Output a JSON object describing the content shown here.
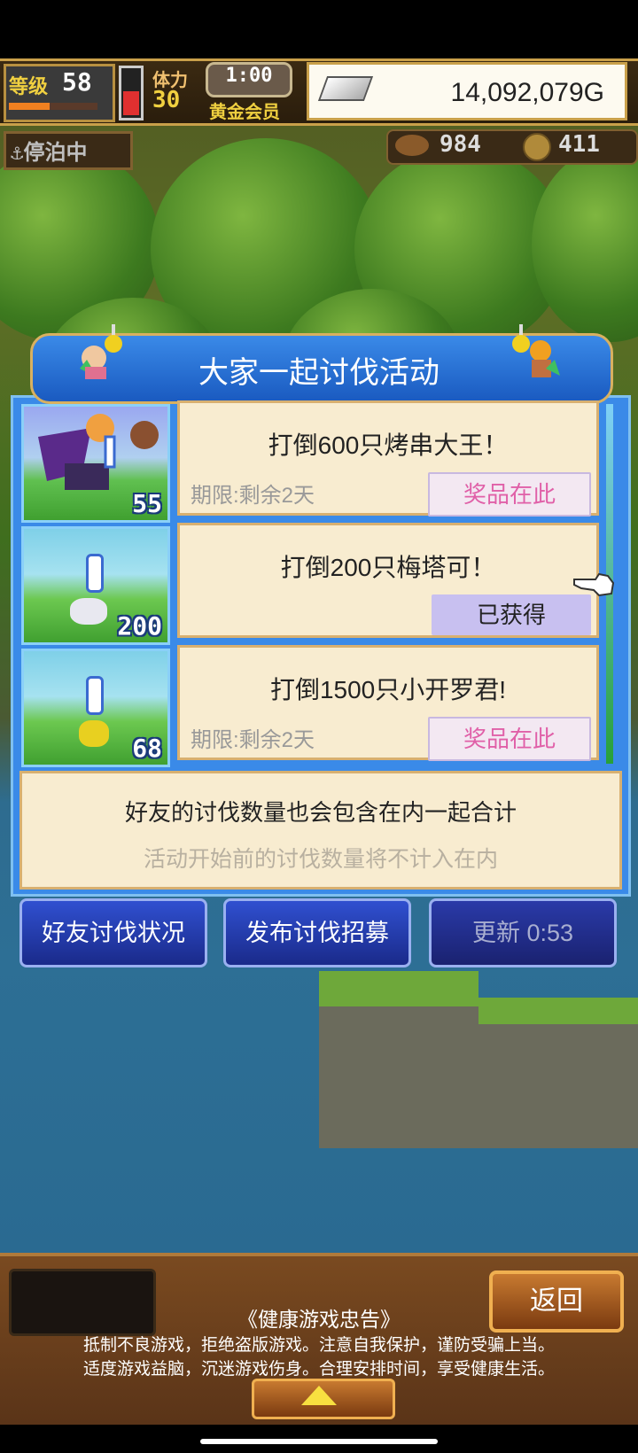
{
  "status_bar": {
    "level_label": "等级",
    "level": "58",
    "level_progress": 0.46,
    "stamina_label": "体力",
    "stamina": "30",
    "timer": "1:00",
    "membership": "黄金会员",
    "gold": "14,092,079G"
  },
  "location": {
    "dock_status": "停泊中",
    "resource1": "984",
    "resource2": "411"
  },
  "dialog": {
    "title": "大家一起讨伐活动",
    "events": [
      {
        "title": "打倒600只烤串大王！",
        "deadline": "期限:剩余2天",
        "button": "奖品在此",
        "count": "55"
      },
      {
        "title": "打倒200只梅塔可！",
        "deadline": "",
        "button": "已获得",
        "count": "200"
      },
      {
        "title": "打倒1500只小开罗君!",
        "deadline": "期限:剩余2天",
        "button": "奖品在此",
        "count": "68"
      }
    ],
    "note_main": "好友的讨伐数量也会包含在内一起合计",
    "note_sub": "活动开始前的讨伐数量将不计入在内"
  },
  "actions": {
    "friends_status": "好友讨伐状况",
    "post_recruit": "发布讨伐招募",
    "refresh": "更新 0:53"
  },
  "bottom": {
    "back": "返回",
    "health_title": "《健康游戏忠告》",
    "health_line1": "抵制不良游戏，拒绝盗版游戏。注意自我保护，谨防受骗上当。",
    "health_line2": "适度游戏益脑，沉迷游戏伤身。合理安排时间，享受健康生活。"
  },
  "colors": {
    "accent_blue": "#3a8ae8",
    "card_bg": "#f8ecd0",
    "prize_pink": "#e060a8"
  }
}
